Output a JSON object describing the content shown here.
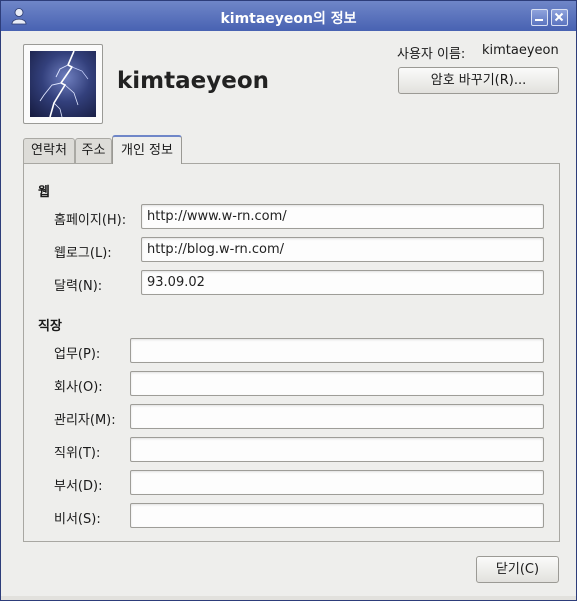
{
  "window": {
    "title": "kimtaeyeon의 정보"
  },
  "header": {
    "display_name": "kimtaeyeon",
    "username_label": "사용자 이름:",
    "username_value": "kimtaeyeon",
    "change_password_label": "암호 바꾸기(R)..."
  },
  "tabs": [
    {
      "label": "연락처",
      "active": false
    },
    {
      "label": "주소",
      "active": false
    },
    {
      "label": "개인 정보",
      "active": true
    }
  ],
  "web": {
    "heading": "웹",
    "fields": [
      {
        "label": "홈페이지(H):",
        "value": "http://www.w-rn.com/"
      },
      {
        "label": "웹로그(L):",
        "value": "http://blog.w-rn.com/"
      },
      {
        "label": "달력(N):",
        "value": "93.09.02"
      }
    ]
  },
  "work": {
    "heading": "직장",
    "fields": [
      {
        "label": "업무(P):",
        "value": ""
      },
      {
        "label": "회사(O):",
        "value": ""
      },
      {
        "label": "관리자(M):",
        "value": ""
      },
      {
        "label": "직위(T):",
        "value": ""
      },
      {
        "label": "부서(D):",
        "value": ""
      },
      {
        "label": "비서(S):",
        "value": ""
      }
    ]
  },
  "footer": {
    "close_label": "닫기(C)"
  },
  "colors": {
    "titlebar": "#5a72bd",
    "window_bg": "#eeeeec",
    "entry_bg": "#fdfdfd"
  },
  "icons": {
    "window_icon": "user-icon",
    "minimize": "minimize-icon",
    "close": "close-icon",
    "photo": "lightning-photo"
  }
}
